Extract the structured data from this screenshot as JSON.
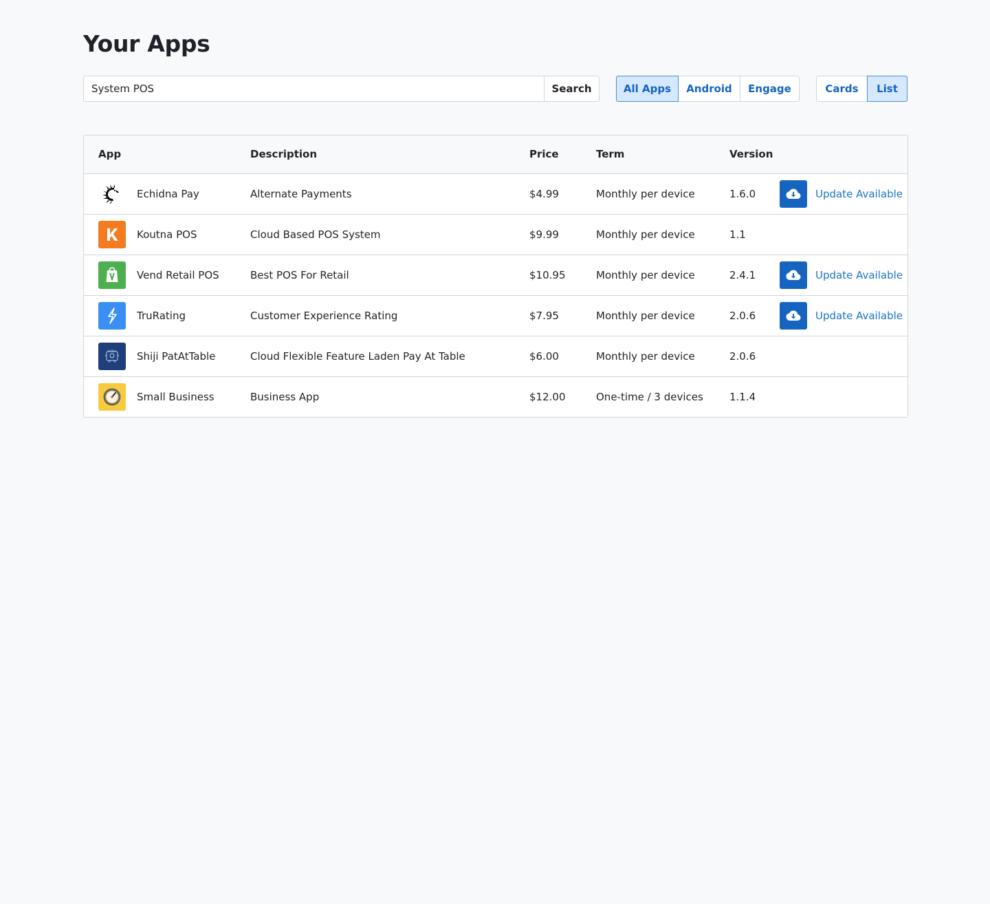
{
  "page": {
    "title": "Your Apps"
  },
  "search": {
    "value": "System POS",
    "button_label": "Search"
  },
  "filters": [
    {
      "label": "All Apps",
      "active": true
    },
    {
      "label": "Android",
      "active": false
    },
    {
      "label": "Engage",
      "active": false
    }
  ],
  "views": [
    {
      "label": "Cards",
      "active": false
    },
    {
      "label": "List",
      "active": true
    }
  ],
  "table": {
    "headers": {
      "app": "App",
      "description": "Description",
      "price": "Price",
      "term": "Term",
      "version": "Version"
    },
    "rows": [
      {
        "icon": "echidna-icon",
        "icon_color": "#ffffff",
        "name": "Echidna Pay",
        "description": "Alternate Payments",
        "price": "$4.99",
        "term": "Monthly per device",
        "version": "1.6.0",
        "update_label": "Update Available"
      },
      {
        "icon": "koutna-k-icon",
        "icon_color": "#f47b20",
        "name": "Koutna POS",
        "description": "Cloud Based POS System",
        "price": "$9.99",
        "term": "Monthly per device",
        "version": "1.1",
        "update_label": ""
      },
      {
        "icon": "vend-bag-icon",
        "icon_color": "#4caf50",
        "name": "Vend Retail POS",
        "description": "Best POS For Retail",
        "price": "$10.95",
        "term": "Monthly per device",
        "version": "2.4.1",
        "update_label": "Update Available"
      },
      {
        "icon": "lightning-bolt-icon",
        "icon_color": "#3b8ff3",
        "name": "TruRating",
        "description": "Customer Experience Rating",
        "price": "$7.95",
        "term": "Monthly per device",
        "version": "2.0.6",
        "update_label": "Update Available"
      },
      {
        "icon": "shiji-table-icon",
        "icon_color": "#1e3f7a",
        "name": "Shiji PatAtTable",
        "description": "Cloud Flexible Feature Laden Pay At Table",
        "price": "$6.00",
        "term": "Monthly per device",
        "version": "2.0.6",
        "update_label": ""
      },
      {
        "icon": "gauge-icon",
        "icon_color": "#f9c93e",
        "name": "Small Business",
        "description": "Business App",
        "price": "$12.00",
        "term": "One-time / 3 devices",
        "version": "1.1.4",
        "update_label": ""
      }
    ]
  },
  "colors": {
    "accent": "#1565c0",
    "link": "#1a73c9",
    "active_bg": "#d6e8fb",
    "border": "#d0d4da",
    "page_bg": "#f8f9fb"
  }
}
